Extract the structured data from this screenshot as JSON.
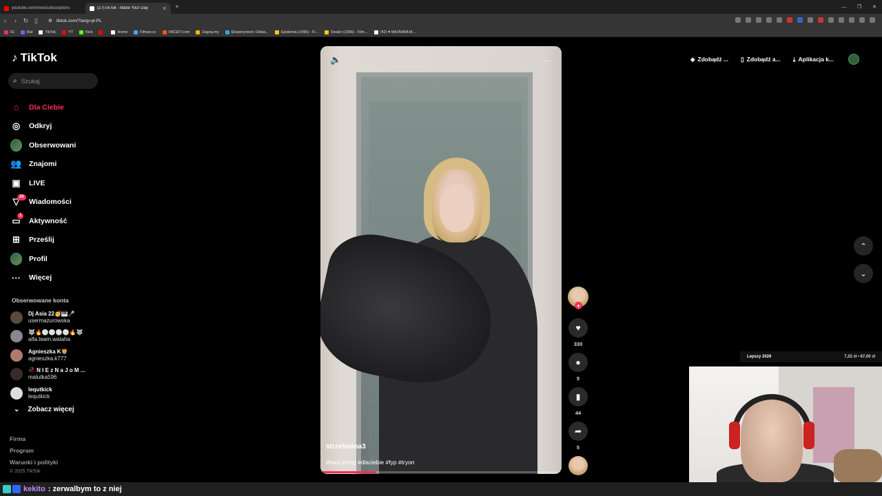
{
  "browser": {
    "tabs": [
      {
        "title": "youtube.com/feed/subscriptions",
        "color": "#ff0000",
        "active": false
      },
      {
        "title": "(27)TikTok - Make Your Day",
        "color": "#ffffff",
        "active": true
      }
    ],
    "new_tab": "+",
    "url": "tiktok.com/?lang=pl-PL",
    "bookmarks": [
      {
        "label": "IG",
        "color": "#e1306c"
      },
      {
        "label": "Rat",
        "color": "#7a5cff"
      },
      {
        "label": "TikTok",
        "color": "#ffffff"
      },
      {
        "label": "YT",
        "color": "#ff0000"
      },
      {
        "label": "Kick",
        "color": "#53fc18"
      },
      {
        "label": "",
        "color": "#ff0000"
      },
      {
        "label": "Home",
        "color": "#ffffff"
      },
      {
        "label": "Filman.cc",
        "color": "#4aa3ff"
      },
      {
        "label": "FACEIT.com",
        "color": "#ff5500"
      },
      {
        "label": "Zagraj.my",
        "color": "#f5b400"
      },
      {
        "label": "Eksperyment: Odsia...",
        "color": "#2aa8e0"
      },
      {
        "label": "Epidemia (1995) - Fi...",
        "color": "#f5c518"
      },
      {
        "label": "Dealer (1996) - Film...",
        "color": "#f5c518"
      },
      {
        "label": "(42) ♥ МАЛЬВИНА...",
        "color": "#ffffff"
      }
    ]
  },
  "tiktok": {
    "logo": "TikTok",
    "search_placeholder": "Szukaj",
    "nav": [
      {
        "label": "Dla Ciebie",
        "icon": "home-icon",
        "glyph": "⌂",
        "active": true
      },
      {
        "label": "Odkryj",
        "icon": "compass-icon",
        "glyph": "◎"
      },
      {
        "label": "Obserwowani",
        "icon": "avatar-icon",
        "glyph": ""
      },
      {
        "label": "Znajomi",
        "icon": "friends-icon",
        "glyph": "👥"
      },
      {
        "label": "LIVE",
        "icon": "live-icon",
        "glyph": "▣"
      },
      {
        "label": "Wiadomości",
        "icon": "messages-icon",
        "glyph": "▽",
        "badge": "26"
      },
      {
        "label": "Aktywność",
        "icon": "activity-icon",
        "glyph": "▭",
        "badge": "1"
      },
      {
        "label": "Prześlij",
        "icon": "upload-icon",
        "glyph": "⊞"
      },
      {
        "label": "Profil",
        "icon": "profile-icon",
        "glyph": ""
      },
      {
        "label": "Więcej",
        "icon": "more-icon",
        "glyph": "···"
      }
    ],
    "following_title": "Obserwowane konta",
    "following": [
      {
        "name": "Dj Asia 22🥳🎹🎤",
        "user": "usermazurowska",
        "color": "#5a4a3a"
      },
      {
        "name": "🐺🔥⚪⚪⚪⚪🔥🐺",
        "user": "alfa.team.wataha",
        "color": "#888888"
      },
      {
        "name": "Agnieszka K🦁",
        "user": "agnieszka.k777",
        "color": "#b07a6a"
      },
      {
        "name": "🥀 N I E z N a J o M ...",
        "user": "malutka596",
        "color": "#3a2a2a"
      },
      {
        "name": "lequtkick",
        "user": "lequtkick",
        "color": "#dddddd"
      }
    ],
    "see_more": "Zobacz więcej",
    "footer_links": [
      "Firma",
      "Program",
      "Warunki i polityki"
    ],
    "copyright": "© 2025 TikTok",
    "top_buttons": [
      {
        "label": "Zdobądź ...",
        "icon": "coin-icon",
        "glyph": "◈"
      },
      {
        "label": "Zdobądź a...",
        "icon": "phone-icon",
        "glyph": "▯"
      },
      {
        "label": "Aplikacja k...",
        "icon": "download-icon",
        "glyph": "⤓"
      }
    ],
    "video": {
      "username": "strzelanina3",
      "hashtags": "#haul #vlog #dlaciebie #fyp #tryon",
      "progress": 0.23,
      "mute_glyph": "🔈",
      "more_glyph": "···"
    },
    "actions": [
      {
        "name": "like",
        "icon": "heart-icon",
        "glyph": "♥",
        "count": "330"
      },
      {
        "name": "comment",
        "icon": "comment-icon",
        "glyph": "●",
        "count": "5"
      },
      {
        "name": "bookmark",
        "icon": "bookmark-icon",
        "glyph": "▮",
        "count": "44"
      },
      {
        "name": "share",
        "icon": "share-icon",
        "glyph": "➦",
        "count": "5"
      }
    ],
    "nav_up": "⌃",
    "nav_down": "⌄"
  },
  "overlay": {
    "ticker_left": "Lepszy 2026",
    "ticker_right": "7,22 zł • 67,00 zł",
    "chat_user": "kekito",
    "chat_msg": ": zerwalbym to z niej"
  }
}
